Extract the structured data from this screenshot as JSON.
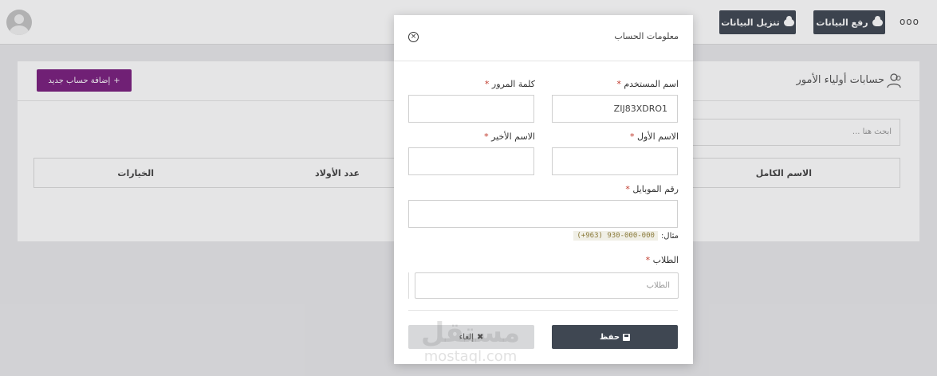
{
  "topbar": {
    "upload_label": "رفع البيانات",
    "download_label": "تنزيل البيانات",
    "more_label": "ooo"
  },
  "card": {
    "title": "حسابات أولياء الأمور",
    "add_button": "إضافة حساب جديد",
    "search_placeholder": "ابحث هنا ...",
    "columns": {
      "full_name": "الاسم الكامل",
      "children_count": "عدد الأولاد",
      "options": "الخيارات"
    }
  },
  "modal": {
    "title": "معلومات الحساب",
    "close_icon": "×",
    "username_label": "اسم المستخدم",
    "username_value": "ZIJ83XDRO1",
    "password_label": "كلمة المرور",
    "password_value": "",
    "first_name_label": "الاسم الأول",
    "first_name_value": "",
    "last_name_label": "الاسم الأخير",
    "last_name_value": "",
    "mobile_label": "رقم الموبايل",
    "mobile_value": "",
    "example_label": "مثال:",
    "example_value": "(+963) 930-000-000",
    "students_label": "الطلاب",
    "students_placeholder": "الطلاب",
    "required_mark": "*",
    "save_label": "حفظ",
    "cancel_label": "إلغاء",
    "cancel_icon": "✖"
  },
  "watermark": {
    "arabic": "مستقل",
    "latin": "mostaql.com"
  }
}
